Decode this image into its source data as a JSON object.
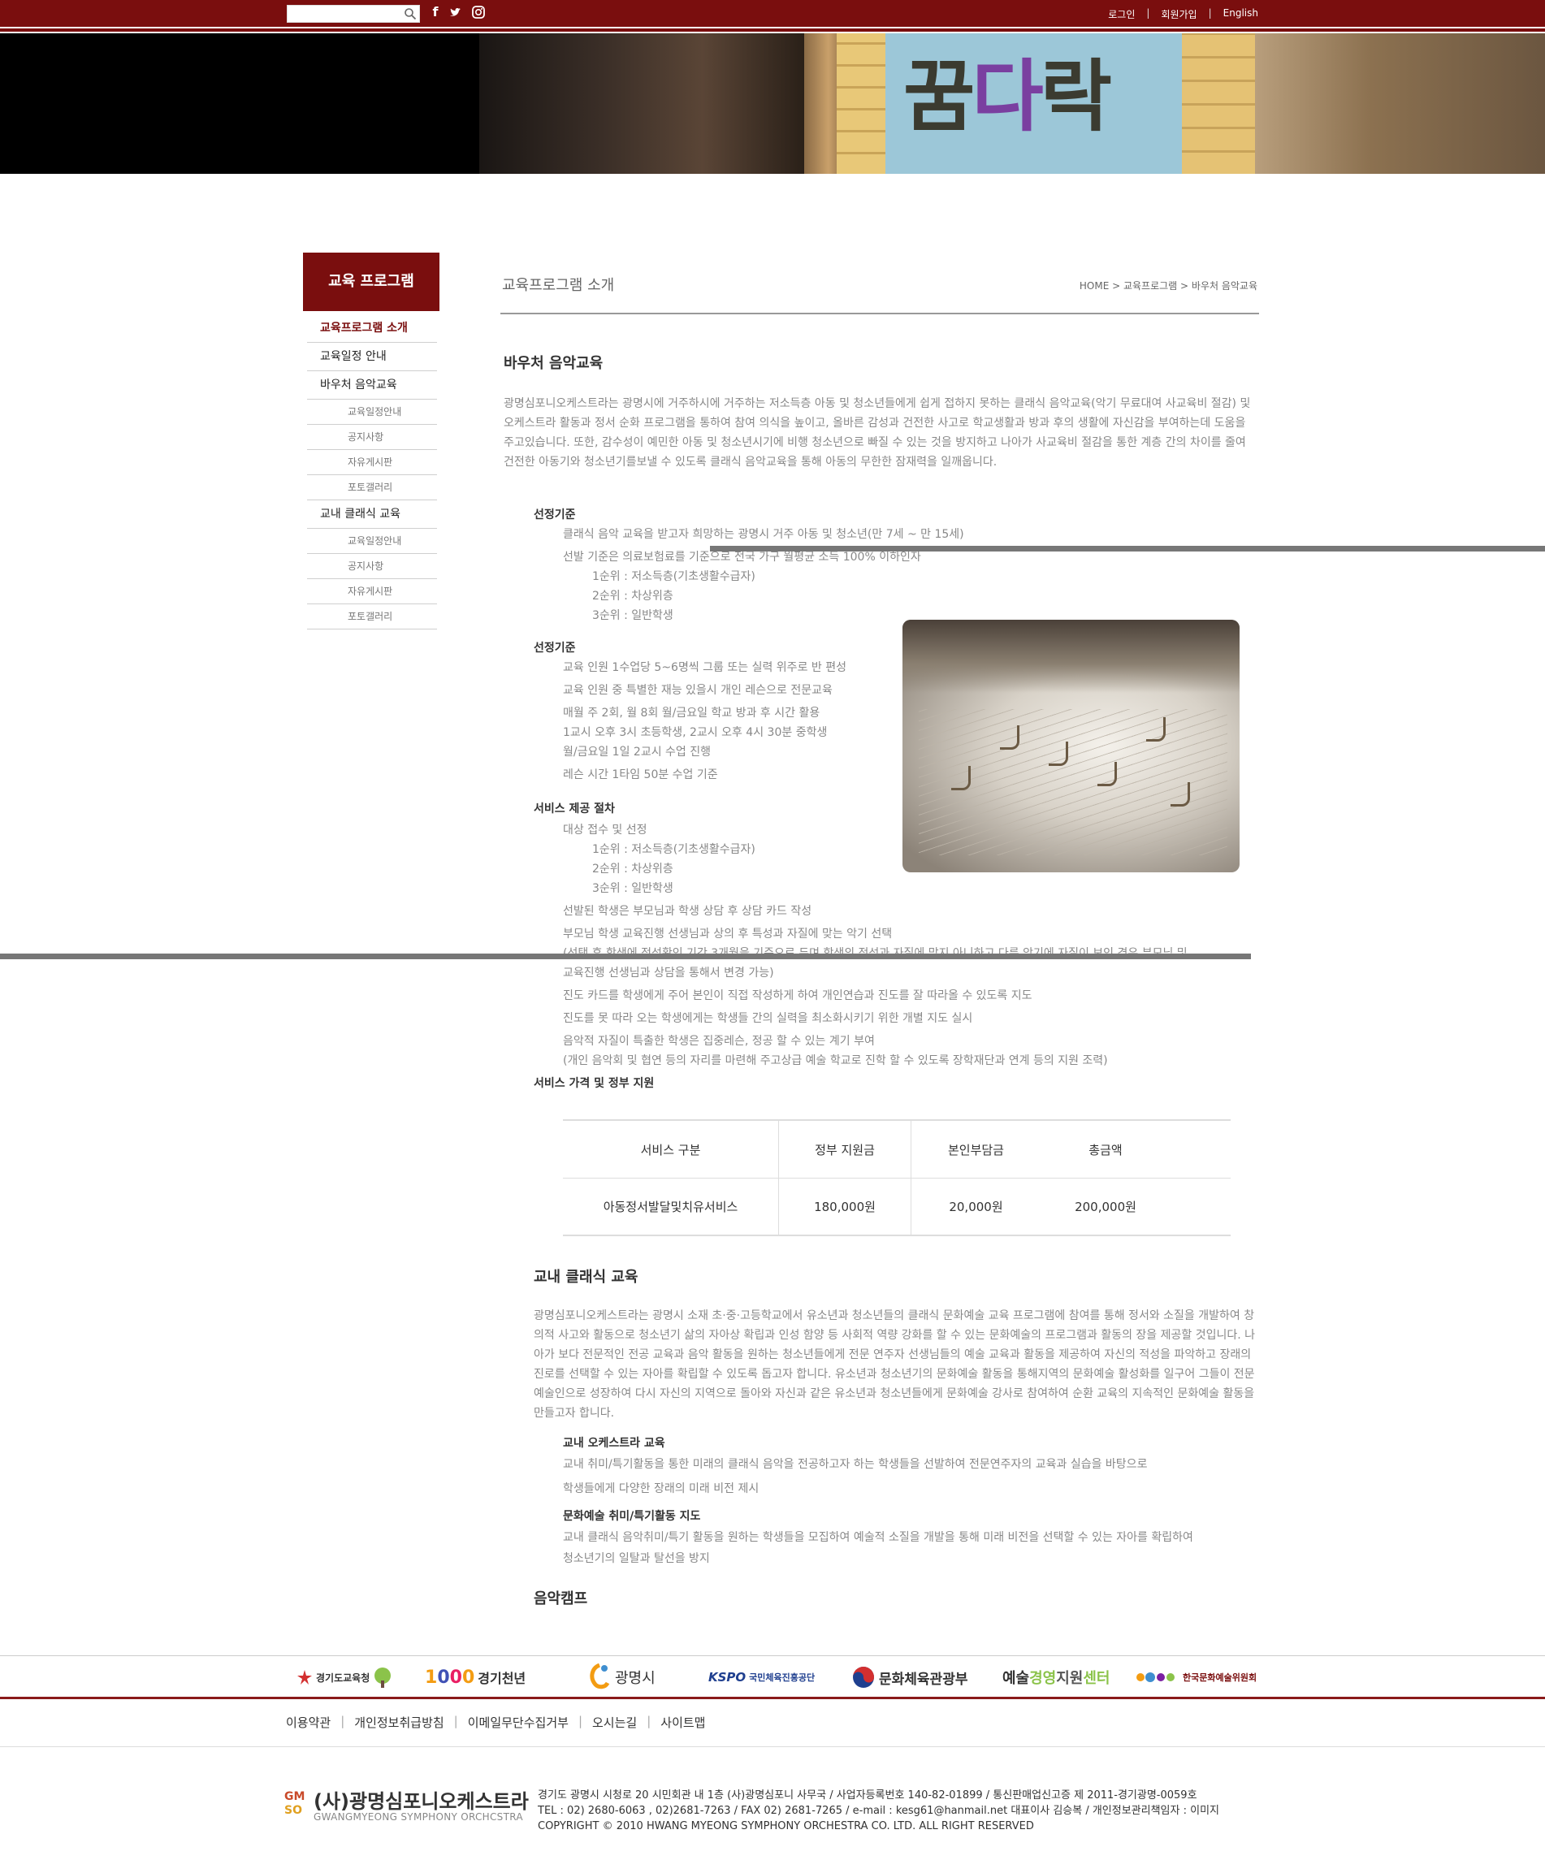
{
  "topbar": {
    "search_placeholder": "",
    "social": [
      "facebook-icon",
      "twitter-icon",
      "instagram-icon"
    ],
    "links": [
      "로그인",
      "회원가입",
      "English"
    ]
  },
  "hero": {
    "sign_text_1": "꿈",
    "sign_text_2": "다",
    "sign_text_3": "락"
  },
  "sidebar": {
    "title": "교육 프로그램",
    "items": [
      {
        "label": "교육프로그램 소개",
        "type": "item",
        "active": true
      },
      {
        "label": "교육일정 안내",
        "type": "item"
      },
      {
        "label": "바우처 음악교육",
        "type": "item"
      },
      {
        "label": "교육일정안내",
        "type": "sub"
      },
      {
        "label": "공지사항",
        "type": "sub"
      },
      {
        "label": "자유게시판",
        "type": "sub"
      },
      {
        "label": "포토갤러리",
        "type": "sub"
      },
      {
        "label": "교내 클래식 교육",
        "type": "item"
      },
      {
        "label": "교육일정안내",
        "type": "sub"
      },
      {
        "label": "공지사항",
        "type": "sub"
      },
      {
        "label": "자유게시판",
        "type": "sub"
      },
      {
        "label": "포토갤러리",
        "type": "sub"
      }
    ]
  },
  "main": {
    "page_title": "교육프로그램 소개",
    "breadcrumb": "HOME > 교육프로그램 > 바우처 음악교육",
    "voucher": {
      "heading": "바우처 음악교육",
      "intro": "광명심포니오케스트라는 광명시에 거주하시에 거주하는 저소득층 아동 및 청소년들에게 쉽게 접하지 못하는 클래식 음악교육(악기 무료대여 사교육비 절감) 및 오케스트라 활동과 정서 순화 프로그램을 통하여 참여 의식을 높이고, 올바른 감성과 건전한 사고로 학교생활과 방과 후의 생활에 자신감을 부여하는데 도움을 주고있습니다.  또한, 감수성이 예민한 아동 및 청소년시기에 비행 청소년으로 빠질 수 있는 것을 방지하고 나아가 사교육비 절감을 통한 계층 간의 차이를 줄여 건전한 아동기와 청소년기를보낼 수 있도록 클래식 음악교육을 통해 아동의 무한한 잠재력을 일깨웁니다.",
      "sec1_title": "선정기준",
      "sec1_lines": [
        "클래식 음악 교육을 받고자 희망하는 광명시 거주 아동 및 청소년(만 7세 ~ 만 15세)",
        "선발 기준은 의료보험료를 기준으로 전국 가구 월평균 소득 100% 이하인자"
      ],
      "sec1_ranks": [
        "1순위 : 저소득층(기초생활수급자)",
        "2순위 : 차상위층",
        "3순위 : 일반학생"
      ],
      "sec2_title": "선정기준",
      "sec2_lines": [
        "교육 인원 1수업당 5~6명씩 그룹 또는 실력 위주로 반 편성",
        "교육 인원 중 특별한 재능 있을시 개인 레슨으로 전문교육",
        "매월 주 2회, 월 8회 월/금요일 학교 방과 후 시간 활용",
        "1교시 오후 3시 초등학생, 2교시 오후 4시 30분 중학생",
        "월/금요일 1일 2교시 수업 진행",
        "레슨 시간 1타임 50분 수업 기준"
      ],
      "sec3_title": "서비스 제공 절차",
      "sec3_line0": "대상 접수 및 선정",
      "sec3_ranks": [
        "1순위 : 저소득층(기초생활수급자)",
        "2순위 : 차상위층",
        "3순위 : 일반학생"
      ],
      "sec3_lines": [
        "선발된 학생은 부모님과 학생 상담 후 상담 카드 작성",
        "부모님 학생 교육진행 선생님과 상의 후 특성과 자질에 맞는 악기 선택",
        "(선택 후 학생에 적성확인 기간 3개월을 기준으로 두며 학생의 적성과 자질에 맞지 아니하고 다른 악기에 자질이 보인 경우 부모님 및",
        "교육진행 선생님과 상담을 통해서 변경 가능)",
        "진도 카드를 학생에게 주어 본인이 직접 작성하게 하여 개인연습과 진도를 잘 따라올 수 있도록 지도",
        "진도를 못 따라 오는 학생에게는 학생들 간의 실력을 최소화시키기 위한 개별 지도 실시",
        "음악적 자질이 특출한 학생은 집중레슨, 정공 할 수 있는 계기 부여",
        "(개인 음악회 및 협연 등의 자리를 마련해 주고상급 예술 학교로 진학 할 수 있도록 장학재단과 연계 등의 지원 조력)"
      ],
      "sec4_title": "서비스 가격 및 정부 지원",
      "table": {
        "headers": [
          "서비스 구분",
          "정부 지원금",
          "본인부담금",
          "총금액"
        ],
        "rows": [
          [
            "아동정서발달및치유서비스",
            "180,000원",
            "20,000원",
            "200,000원"
          ]
        ]
      }
    },
    "school": {
      "heading": "교내 클래식 교육",
      "intro": "광명심포니오케스트라는 광명시 소재 초·중·고등학교에서 유소년과 청소년들의 클래식 문화예술 교육 프로그램에 참여를 통해 정서와 소질을 개발하여 창의적 사고와 활동으로 청소년기 삶의 자아상 확립과 인성 함양 등 사회적 역량 강화를 할 수 있는 문화예술의 프로그램과 활동의 장을 제공할 것입니다. 나아가 보다 전문적인 전공 교육과 음악 활동을 원하는 청소년들에게 전문 연주자 선생님들의 예술 교육과 활동을 제공하여 자신의 적성을 파악하고 장래의 진로를 선택할 수 있는 자아를 확립할 수 있도록 돕고자 합니다. 유소년과 청소년기의 문화예술 활동을 통해지역의 문화예술 활성화를 일구어 그들이 전문예술인으로 성장하여 다시 자신의 지역으로 돌아와 자신과 같은 유소년과 청소년들에게 문화예술 강사로 참여하여 순환 교육의 지속적인 문화예술 활동을 만들고자 합니다.",
      "orch_title": "교내 오케스트라 교육",
      "orch_lines": [
        "교내 취미/특기활동을 통한 미래의 클래식 음악을 전공하고자 하는 학생들을 선발하여 전문연주자의 교육과 실습을 바탕으로",
        "학생들에게 다양한 장래의 미래 비전 제시"
      ],
      "art_title": "문화예술 취미/특기활동 지도",
      "art_lines": [
        "교내 클래식 음악취미/특기 활동을 원하는 학생들을 모집하여 예술적 소질을 개발을 통해 미래 비전을 선택할 수 있는 자아를 확립하여",
        "청소년기의 일탈과 탈선을 방지"
      ]
    },
    "camp_heading": "음악캠프"
  },
  "partners": [
    {
      "icon": "gyeonggi-edu-logo",
      "label": "경기도교육청"
    },
    {
      "icon": "gyeonggi-1000-logo",
      "label": "1000 경기천년"
    },
    {
      "icon": "gwangmyeong-city-logo",
      "label": "광명시"
    },
    {
      "icon": "kspo-logo",
      "label": "KSPO 국민체육진흥공단"
    },
    {
      "icon": "mcst-logo",
      "label": "문화체육관광부"
    },
    {
      "icon": "arts-mgmt-logo",
      "label": "예술경영지원센터"
    },
    {
      "icon": "arko-logo",
      "label": "한국문화예술위원회"
    }
  ],
  "footer": {
    "links": [
      "이용약관",
      "개인정보취급방침",
      "이메일무단수집거부",
      "오시는길",
      "사이트맵"
    ],
    "org_name": "(사)광명심포니오케스트라",
    "org_sub": "GWANGMYEONG SYMPHONY ORCHCSTRA",
    "addr_1": "경기도 광명시 시청로 20 시민회관 내 1층 (사)광명심포니 사무국 / 사업자등록번호 140-82-01899 / 통신판매업신고증 제 2011-경기광명-0059호",
    "addr_2": "TEL : 02) 2680-6063 , 02)2681-7263 / FAX 02) 2681-7265 / e-mail : kesg61@hanmail.net 대표이사 김승복 / 개인정보관리책임자 : 이미지",
    "addr_3": "COPYRIGHT © 2010 HWANG MYEONG SYMPHONY ORCHESTRA CO. LTD.  ALL RIGHT RESERVED"
  },
  "colors": {
    "brand": "#7a0e0e",
    "accent_line": "#8a1a1a"
  }
}
